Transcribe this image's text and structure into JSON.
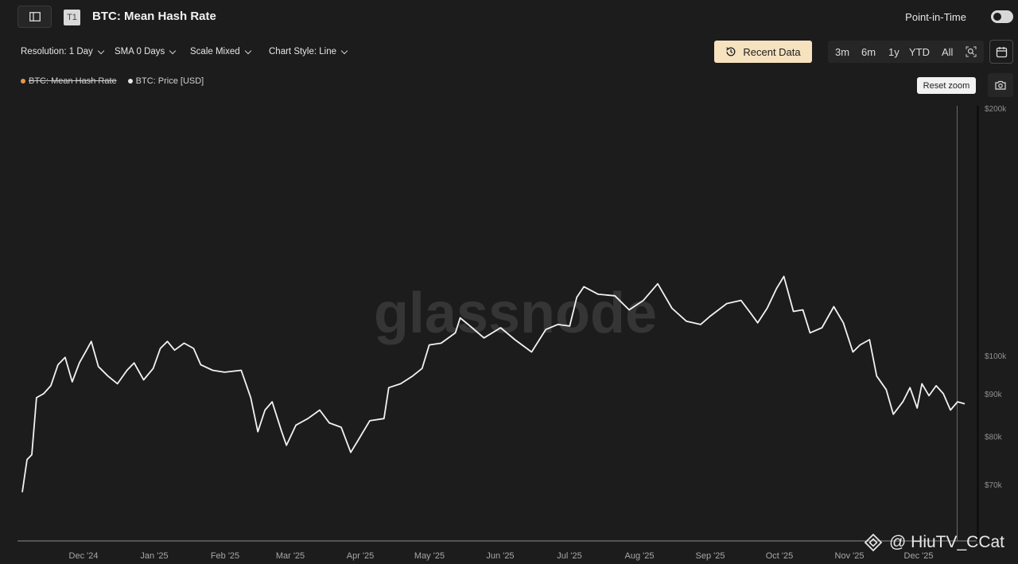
{
  "header": {
    "badge": "T1",
    "title": "BTC: Mean Hash Rate",
    "point_in_time_label": "Point-in-Time"
  },
  "controls": {
    "resolution": "Resolution: 1 Day",
    "sma": "SMA 0 Days",
    "scale": "Scale Mixed",
    "chart_style": "Chart Style: Line"
  },
  "toolbar": {
    "recent_data_label": "Recent Data",
    "ranges": [
      "3m",
      "6m",
      "1y",
      "YTD",
      "All"
    ],
    "reset_zoom_label": "Reset zoom"
  },
  "legend": {
    "items": [
      {
        "label": "BTC: Mean Hash Rate",
        "color": "#e8954a",
        "hidden": true
      },
      {
        "label": "BTC: Price [USD]",
        "color": "#e6e6e6",
        "hidden": false
      }
    ]
  },
  "watermark": {
    "brand": "glassnode",
    "handle": "@ HiuTV_CCat"
  },
  "colors": {
    "background": "#1c1c1c",
    "line": "#f2f2f2",
    "accent_button": "#f6e2bf"
  },
  "chart_data": {
    "type": "line",
    "scale": "log",
    "series": [
      {
        "name": "BTC: Price [USD]",
        "points": [
          [
            "2024-11-20",
            68500
          ],
          [
            "2024-11-22",
            75000
          ],
          [
            "2024-11-24",
            76000
          ],
          [
            "2024-11-26",
            89000
          ],
          [
            "2024-11-29",
            90000
          ],
          [
            "2024-12-02",
            92000
          ],
          [
            "2024-12-05",
            97500
          ],
          [
            "2024-12-08",
            99500
          ],
          [
            "2024-12-11",
            93000
          ],
          [
            "2024-12-14",
            98000
          ],
          [
            "2024-12-17",
            101500
          ],
          [
            "2024-12-19",
            104000
          ],
          [
            "2024-12-22",
            97000
          ],
          [
            "2024-12-26",
            94500
          ],
          [
            "2024-12-30",
            92500
          ],
          [
            "2025-01-03",
            96000
          ],
          [
            "2025-01-06",
            98000
          ],
          [
            "2025-01-10",
            93500
          ],
          [
            "2025-01-14",
            96500
          ],
          [
            "2025-01-17",
            102000
          ],
          [
            "2025-01-20",
            104000
          ],
          [
            "2025-01-23",
            101500
          ],
          [
            "2025-01-27",
            103500
          ],
          [
            "2025-01-31",
            102000
          ],
          [
            "2025-02-03",
            97500
          ],
          [
            "2025-02-08",
            96000
          ],
          [
            "2025-02-13",
            95500
          ],
          [
            "2025-02-20",
            96000
          ],
          [
            "2025-02-24",
            89000
          ],
          [
            "2025-02-27",
            81000
          ],
          [
            "2025-03-02",
            86000
          ],
          [
            "2025-03-05",
            88000
          ],
          [
            "2025-03-09",
            81000
          ],
          [
            "2025-03-11",
            78000
          ],
          [
            "2025-03-15",
            82500
          ],
          [
            "2025-03-20",
            84000
          ],
          [
            "2025-03-25",
            86000
          ],
          [
            "2025-03-29",
            83000
          ],
          [
            "2025-04-03",
            82000
          ],
          [
            "2025-04-07",
            76500
          ],
          [
            "2025-04-10",
            79000
          ],
          [
            "2025-04-15",
            83500
          ],
          [
            "2025-04-21",
            84000
          ],
          [
            "2025-04-23",
            91500
          ],
          [
            "2025-04-28",
            92500
          ],
          [
            "2025-05-03",
            94500
          ],
          [
            "2025-05-07",
            96500
          ],
          [
            "2025-05-10",
            103000
          ],
          [
            "2025-05-15",
            103500
          ],
          [
            "2025-05-21",
            106500
          ],
          [
            "2025-05-23",
            111000
          ],
          [
            "2025-05-28",
            108000
          ],
          [
            "2025-06-02",
            105000
          ],
          [
            "2025-06-09",
            108000
          ],
          [
            "2025-06-15",
            104500
          ],
          [
            "2025-06-22",
            101000
          ],
          [
            "2025-06-28",
            107500
          ],
          [
            "2025-07-03",
            109000
          ],
          [
            "2025-07-08",
            108500
          ],
          [
            "2025-07-11",
            117500
          ],
          [
            "2025-07-14",
            121000
          ],
          [
            "2025-07-20",
            118500
          ],
          [
            "2025-07-27",
            118000
          ],
          [
            "2025-08-02",
            113500
          ],
          [
            "2025-08-08",
            116500
          ],
          [
            "2025-08-14",
            122000
          ],
          [
            "2025-08-20",
            114000
          ],
          [
            "2025-08-26",
            110000
          ],
          [
            "2025-09-01",
            109000
          ],
          [
            "2025-09-05",
            111500
          ],
          [
            "2025-09-12",
            115500
          ],
          [
            "2025-09-18",
            116500
          ],
          [
            "2025-09-22",
            112500
          ],
          [
            "2025-09-25",
            109500
          ],
          [
            "2025-09-29",
            114000
          ],
          [
            "2025-10-03",
            120500
          ],
          [
            "2025-10-06",
            124500
          ],
          [
            "2025-10-10",
            113000
          ],
          [
            "2025-10-14",
            113500
          ],
          [
            "2025-10-17",
            106500
          ],
          [
            "2025-10-22",
            108000
          ],
          [
            "2025-10-27",
            114500
          ],
          [
            "2025-10-31",
            109500
          ],
          [
            "2025-11-04",
            101000
          ],
          [
            "2025-11-07",
            103000
          ],
          [
            "2025-11-11",
            104500
          ],
          [
            "2025-11-14",
            94500
          ],
          [
            "2025-11-18",
            91000
          ],
          [
            "2025-11-21",
            85000
          ],
          [
            "2025-11-25",
            88000
          ],
          [
            "2025-11-28",
            91500
          ],
          [
            "2025-12-01",
            86500
          ],
          [
            "2025-12-03",
            92500
          ],
          [
            "2025-12-06",
            89500
          ],
          [
            "2025-12-09",
            92000
          ],
          [
            "2025-12-12",
            90000
          ],
          [
            "2025-12-15",
            86000
          ],
          [
            "2025-12-18",
            88000
          ],
          [
            "2025-12-21",
            87500
          ]
        ]
      }
    ],
    "x_ticks": [
      "Dec '24",
      "Jan '25",
      "Feb '25",
      "Mar '25",
      "Apr '25",
      "May '25",
      "Jun '25",
      "Jul '25",
      "Aug '25",
      "Sep '25",
      "Oct '25",
      "Nov '25",
      "Dec '25"
    ],
    "y_ticks": [
      "$200k",
      "$100k",
      "$90k",
      "$80k",
      "$70k"
    ],
    "y_tick_values": [
      200000,
      100000,
      90000,
      80000,
      70000
    ],
    "xlim": [
      "2024-11-18",
      "2025-12-24"
    ]
  }
}
